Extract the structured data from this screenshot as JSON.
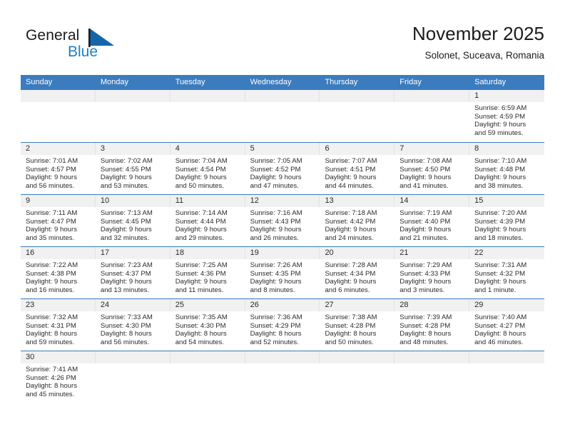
{
  "brand": {
    "name_line1": "General",
    "name_line2": "Blue",
    "flag_icon": "blue-triangle-flag-icon",
    "color_dark": "#1b1b1b",
    "color_blue": "#1e7fc6"
  },
  "header": {
    "title": "November 2025",
    "subtitle": "Solonet, Suceava, Romania"
  },
  "theme": {
    "header_bg": "#3a7cbe",
    "header_text": "#ffffff",
    "day_band_bg": "#f1f1f1",
    "row_divider": "#3a7cbe",
    "cell_divider": "#e2e2e2",
    "body_text": "#2b2b2b"
  },
  "weekdays": [
    "Sunday",
    "Monday",
    "Tuesday",
    "Wednesday",
    "Thursday",
    "Friday",
    "Saturday"
  ],
  "labels": {
    "sunrise": "Sunrise:",
    "sunset": "Sunset:",
    "daylight": "Daylight:"
  },
  "weeks": [
    [
      {
        "date": "",
        "empty": true
      },
      {
        "date": "",
        "empty": true
      },
      {
        "date": "",
        "empty": true
      },
      {
        "date": "",
        "empty": true
      },
      {
        "date": "",
        "empty": true
      },
      {
        "date": "",
        "empty": true
      },
      {
        "date": "1",
        "sunrise": "Sunrise: 6:59 AM",
        "sunset": "Sunset: 4:59 PM",
        "daylight_l1": "Daylight: 9 hours",
        "daylight_l2": "and 59 minutes."
      }
    ],
    [
      {
        "date": "2",
        "sunrise": "Sunrise: 7:01 AM",
        "sunset": "Sunset: 4:57 PM",
        "daylight_l1": "Daylight: 9 hours",
        "daylight_l2": "and 56 minutes."
      },
      {
        "date": "3",
        "sunrise": "Sunrise: 7:02 AM",
        "sunset": "Sunset: 4:55 PM",
        "daylight_l1": "Daylight: 9 hours",
        "daylight_l2": "and 53 minutes."
      },
      {
        "date": "4",
        "sunrise": "Sunrise: 7:04 AM",
        "sunset": "Sunset: 4:54 PM",
        "daylight_l1": "Daylight: 9 hours",
        "daylight_l2": "and 50 minutes."
      },
      {
        "date": "5",
        "sunrise": "Sunrise: 7:05 AM",
        "sunset": "Sunset: 4:52 PM",
        "daylight_l1": "Daylight: 9 hours",
        "daylight_l2": "and 47 minutes."
      },
      {
        "date": "6",
        "sunrise": "Sunrise: 7:07 AM",
        "sunset": "Sunset: 4:51 PM",
        "daylight_l1": "Daylight: 9 hours",
        "daylight_l2": "and 44 minutes."
      },
      {
        "date": "7",
        "sunrise": "Sunrise: 7:08 AM",
        "sunset": "Sunset: 4:50 PM",
        "daylight_l1": "Daylight: 9 hours",
        "daylight_l2": "and 41 minutes."
      },
      {
        "date": "8",
        "sunrise": "Sunrise: 7:10 AM",
        "sunset": "Sunset: 4:48 PM",
        "daylight_l1": "Daylight: 9 hours",
        "daylight_l2": "and 38 minutes."
      }
    ],
    [
      {
        "date": "9",
        "sunrise": "Sunrise: 7:11 AM",
        "sunset": "Sunset: 4:47 PM",
        "daylight_l1": "Daylight: 9 hours",
        "daylight_l2": "and 35 minutes."
      },
      {
        "date": "10",
        "sunrise": "Sunrise: 7:13 AM",
        "sunset": "Sunset: 4:45 PM",
        "daylight_l1": "Daylight: 9 hours",
        "daylight_l2": "and 32 minutes."
      },
      {
        "date": "11",
        "sunrise": "Sunrise: 7:14 AM",
        "sunset": "Sunset: 4:44 PM",
        "daylight_l1": "Daylight: 9 hours",
        "daylight_l2": "and 29 minutes."
      },
      {
        "date": "12",
        "sunrise": "Sunrise: 7:16 AM",
        "sunset": "Sunset: 4:43 PM",
        "daylight_l1": "Daylight: 9 hours",
        "daylight_l2": "and 26 minutes."
      },
      {
        "date": "13",
        "sunrise": "Sunrise: 7:18 AM",
        "sunset": "Sunset: 4:42 PM",
        "daylight_l1": "Daylight: 9 hours",
        "daylight_l2": "and 24 minutes."
      },
      {
        "date": "14",
        "sunrise": "Sunrise: 7:19 AM",
        "sunset": "Sunset: 4:40 PM",
        "daylight_l1": "Daylight: 9 hours",
        "daylight_l2": "and 21 minutes."
      },
      {
        "date": "15",
        "sunrise": "Sunrise: 7:20 AM",
        "sunset": "Sunset: 4:39 PM",
        "daylight_l1": "Daylight: 9 hours",
        "daylight_l2": "and 18 minutes."
      }
    ],
    [
      {
        "date": "16",
        "sunrise": "Sunrise: 7:22 AM",
        "sunset": "Sunset: 4:38 PM",
        "daylight_l1": "Daylight: 9 hours",
        "daylight_l2": "and 16 minutes."
      },
      {
        "date": "17",
        "sunrise": "Sunrise: 7:23 AM",
        "sunset": "Sunset: 4:37 PM",
        "daylight_l1": "Daylight: 9 hours",
        "daylight_l2": "and 13 minutes."
      },
      {
        "date": "18",
        "sunrise": "Sunrise: 7:25 AM",
        "sunset": "Sunset: 4:36 PM",
        "daylight_l1": "Daylight: 9 hours",
        "daylight_l2": "and 11 minutes."
      },
      {
        "date": "19",
        "sunrise": "Sunrise: 7:26 AM",
        "sunset": "Sunset: 4:35 PM",
        "daylight_l1": "Daylight: 9 hours",
        "daylight_l2": "and 8 minutes."
      },
      {
        "date": "20",
        "sunrise": "Sunrise: 7:28 AM",
        "sunset": "Sunset: 4:34 PM",
        "daylight_l1": "Daylight: 9 hours",
        "daylight_l2": "and 6 minutes."
      },
      {
        "date": "21",
        "sunrise": "Sunrise: 7:29 AM",
        "sunset": "Sunset: 4:33 PM",
        "daylight_l1": "Daylight: 9 hours",
        "daylight_l2": "and 3 minutes."
      },
      {
        "date": "22",
        "sunrise": "Sunrise: 7:31 AM",
        "sunset": "Sunset: 4:32 PM",
        "daylight_l1": "Daylight: 9 hours",
        "daylight_l2": "and 1 minute."
      }
    ],
    [
      {
        "date": "23",
        "sunrise": "Sunrise: 7:32 AM",
        "sunset": "Sunset: 4:31 PM",
        "daylight_l1": "Daylight: 8 hours",
        "daylight_l2": "and 59 minutes."
      },
      {
        "date": "24",
        "sunrise": "Sunrise: 7:33 AM",
        "sunset": "Sunset: 4:30 PM",
        "daylight_l1": "Daylight: 8 hours",
        "daylight_l2": "and 56 minutes."
      },
      {
        "date": "25",
        "sunrise": "Sunrise: 7:35 AM",
        "sunset": "Sunset: 4:30 PM",
        "daylight_l1": "Daylight: 8 hours",
        "daylight_l2": "and 54 minutes."
      },
      {
        "date": "26",
        "sunrise": "Sunrise: 7:36 AM",
        "sunset": "Sunset: 4:29 PM",
        "daylight_l1": "Daylight: 8 hours",
        "daylight_l2": "and 52 minutes."
      },
      {
        "date": "27",
        "sunrise": "Sunrise: 7:38 AM",
        "sunset": "Sunset: 4:28 PM",
        "daylight_l1": "Daylight: 8 hours",
        "daylight_l2": "and 50 minutes."
      },
      {
        "date": "28",
        "sunrise": "Sunrise: 7:39 AM",
        "sunset": "Sunset: 4:28 PM",
        "daylight_l1": "Daylight: 8 hours",
        "daylight_l2": "and 48 minutes."
      },
      {
        "date": "29",
        "sunrise": "Sunrise: 7:40 AM",
        "sunset": "Sunset: 4:27 PM",
        "daylight_l1": "Daylight: 8 hours",
        "daylight_l2": "and 46 minutes."
      }
    ],
    [
      {
        "date": "30",
        "sunrise": "Sunrise: 7:41 AM",
        "sunset": "Sunset: 4:26 PM",
        "daylight_l1": "Daylight: 8 hours",
        "daylight_l2": "and 45 minutes."
      },
      {
        "date": "",
        "empty": true
      },
      {
        "date": "",
        "empty": true
      },
      {
        "date": "",
        "empty": true
      },
      {
        "date": "",
        "empty": true
      },
      {
        "date": "",
        "empty": true
      },
      {
        "date": "",
        "empty": true
      }
    ]
  ]
}
